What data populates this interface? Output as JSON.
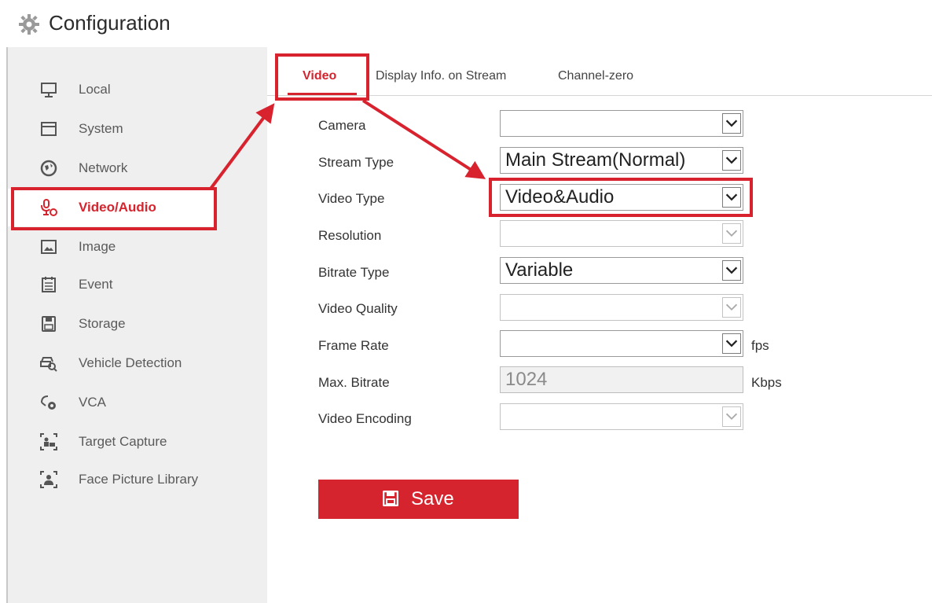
{
  "header": {
    "title": "Configuration",
    "icon": "gear-icon"
  },
  "sidebar": {
    "items": [
      {
        "label": "Local",
        "icon": "monitor-icon"
      },
      {
        "label": "System",
        "icon": "window-icon"
      },
      {
        "label": "Network",
        "icon": "globe-icon"
      },
      {
        "label": "Video/Audio",
        "icon": "microphone-icon",
        "active": true
      },
      {
        "label": "Image",
        "icon": "image-icon"
      },
      {
        "label": "Event",
        "icon": "calendar-icon"
      },
      {
        "label": "Storage",
        "icon": "floppy-icon"
      },
      {
        "label": "Vehicle Detection",
        "icon": "vehicle-search-icon"
      },
      {
        "label": "VCA",
        "icon": "vca-icon"
      },
      {
        "label": "Target Capture",
        "icon": "target-capture-icon"
      },
      {
        "label": "Face Picture Library",
        "icon": "face-library-icon"
      }
    ]
  },
  "tabs": [
    {
      "label": "Video",
      "active": true
    },
    {
      "label": "Display Info. on Stream"
    },
    {
      "label": "Channel-zero"
    }
  ],
  "form": {
    "camera": {
      "label": "Camera",
      "value": ""
    },
    "stream_type": {
      "label": "Stream Type",
      "value": "Main Stream(Normal)"
    },
    "video_type": {
      "label": "Video Type",
      "value": "Video&Audio"
    },
    "resolution": {
      "label": "Resolution",
      "value": ""
    },
    "bitrate_type": {
      "label": "Bitrate Type",
      "value": "Variable"
    },
    "video_quality": {
      "label": "Video Quality",
      "value": ""
    },
    "frame_rate": {
      "label": "Frame Rate",
      "value": "",
      "unit": "fps"
    },
    "max_bitrate": {
      "label": "Max. Bitrate",
      "value": "1024",
      "unit": "Kbps"
    },
    "video_encoding": {
      "label": "Video Encoding",
      "value": ""
    }
  },
  "save_button": {
    "label": "Save"
  },
  "colors": {
    "accent": "#d6242e",
    "annotation": "#d8232f",
    "sidebar_bg": "#efefef"
  }
}
